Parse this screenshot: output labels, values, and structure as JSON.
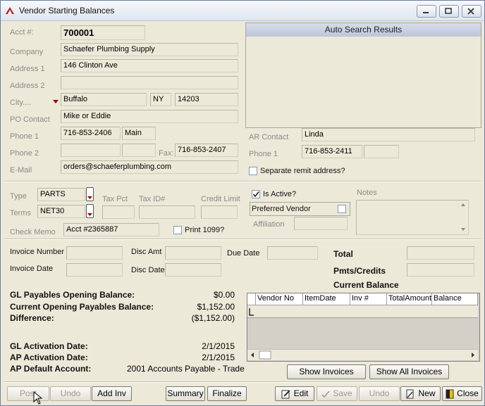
{
  "window": {
    "title": "Vendor Starting Balances"
  },
  "vendor": {
    "acct_label": "Acct #:",
    "acct_value": "700001",
    "company_label": "Company",
    "company_value": "Schaefer Plumbing Supply",
    "address1_label": "Address 1",
    "address1_value": "146 Clinton Ave",
    "address2_label": "Address 2",
    "address2_value": "",
    "city_label": "City....",
    "city_value": "Buffalo",
    "state_value": "NY",
    "zip_value": "14203",
    "po_contact_label": "PO Contact",
    "po_contact_value": "Mike or Eddie",
    "phone1_label": "Phone 1",
    "phone1_value": "716-853-2406",
    "phone1_type": "Main",
    "phone2_label": "Phone 2",
    "phone2_value": "",
    "phone2_type": "",
    "fax_label": "Fax:",
    "fax_value": "716-853-2407",
    "email_label": "E-Mail",
    "email_value": "orders@schaeferplumbing.com"
  },
  "auto_search": {
    "title": "Auto Search Results"
  },
  "ar": {
    "contact_label": "AR Contact",
    "contact_value": "Linda",
    "phone1_label": "Phone 1",
    "phone1_value": "716-853-2411",
    "phone1_ext": "",
    "separate_remit_label": "Separate remit address?",
    "separate_remit_checked": false
  },
  "terms": {
    "type_label": "Type",
    "type_value": "PARTS",
    "terms_label": "Terms",
    "terms_value": "NET30",
    "tax_pct_label": "Tax Pct",
    "tax_pct_value": "",
    "tax_id_label": "Tax ID#",
    "tax_id_value": "",
    "credit_limit_label": "Credit Limit",
    "credit_limit_value": "",
    "check_memo_label": "Check Memo",
    "check_memo_value": "Acct #2365887",
    "print1099_label": "Print 1099?",
    "print1099_checked": false,
    "is_active_label": "Is Active?",
    "is_active_checked": true,
    "preferred_vendor_label": "Preferred Vendor",
    "preferred_vendor_checked": false,
    "affiliation_label": "Affiliation",
    "affiliation_value": "",
    "notes_label": "Notes"
  },
  "invoice": {
    "number_label": "Invoice Number",
    "disc_amt_label": "Disc Amt",
    "due_date_label": "Due Date",
    "date_label": "Invoice Date",
    "disc_date_label": "Disc Date",
    "total_label": "Total",
    "pmts_label": "Pmts/Credits",
    "current_balance_label": "Current Balance"
  },
  "balances": {
    "gl_opening_label": "GL Payables Opening Balance:",
    "gl_opening_value": "$0.00",
    "current_opening_label": "Current Opening Payables Balance:",
    "current_opening_value": "$1,152.00",
    "difference_label": "Difference:",
    "difference_value": "($1,152.00)",
    "gl_activation_label": "GL Activation Date:",
    "gl_activation_value": "2/1/2015",
    "ap_activation_label": "AP Activation Date:",
    "ap_activation_value": "2/1/2015",
    "ap_default_label": "AP Default Account:",
    "ap_default_value": "2001  Accounts Payable - Trade"
  },
  "grid": {
    "columns": [
      "Vendor No",
      "ItemDate",
      "Inv #",
      "TotalAmount",
      "Balance"
    ]
  },
  "buttons": {
    "show_invoices": "Show Invoices",
    "show_all_invoices": "Show All Invoices",
    "post": "Post",
    "undo1": "Undo",
    "add_inv": "Add Inv",
    "summary": "Summary",
    "finalize": "Finalize",
    "edit": "Edit",
    "save": "Save",
    "undo2": "Undo",
    "new": "New",
    "close": "Close"
  }
}
